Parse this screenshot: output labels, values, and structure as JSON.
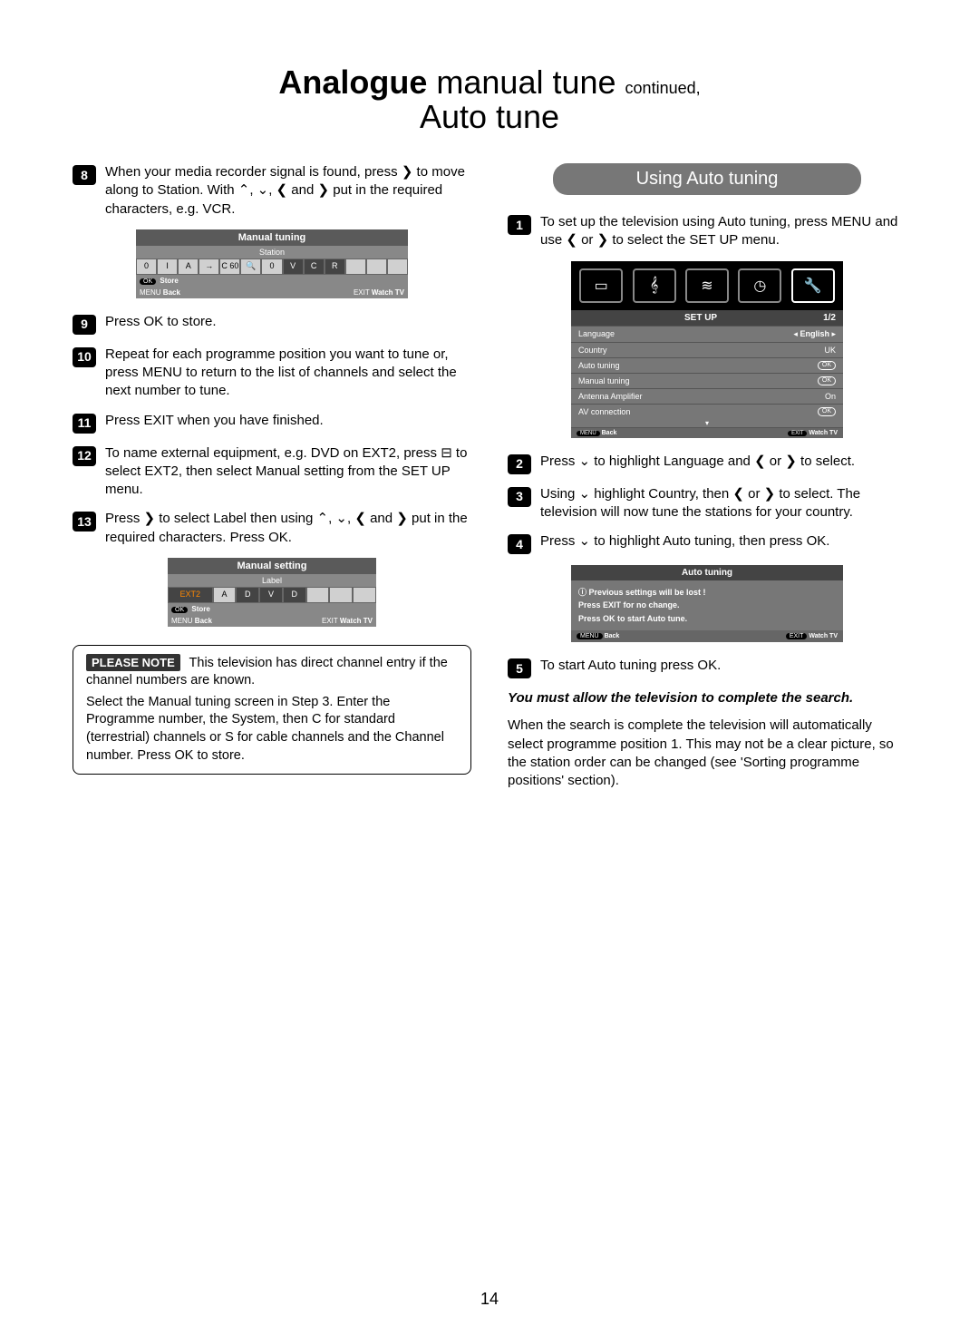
{
  "title": {
    "bold": "Analogue",
    "rest": " manual tune ",
    "cont": "continued,",
    "line2": "Auto tune"
  },
  "left": {
    "step8": "When your media recorder signal is found, press ❯ to move along to Station. With ⌃, ⌄, ❮ and ❯ put in the required characters, e.g. VCR.",
    "osd1": {
      "title": "Manual tuning",
      "sub": "Station",
      "cells": [
        "0",
        "I",
        "A",
        "→",
        "C 60",
        "🔍",
        "0",
        "V",
        "C",
        "R",
        "",
        "",
        ""
      ],
      "f1a": "OK",
      "f1b": "Store",
      "f2a": "MENU",
      "f2b": "Back",
      "f3a": "EXIT",
      "f3b": "Watch TV"
    },
    "step9": "Press OK to store.",
    "step10": "Repeat for each programme position you want to tune or, press MENU to return to the list of channels and select the next number to tune.",
    "step11": "Press EXIT when you have finished.",
    "step12": "To name external equipment, e.g. DVD on EXT2, press  ⊟  to select EXT2, then select Manual setting from the SET UP menu.",
    "step13": "Press ❯ to select Label then using ⌃, ⌄, ❮ and ❯ put in the required characters. Press OK.",
    "osd2": {
      "title": "Manual setting",
      "sub": "Label",
      "ext": "EXT2",
      "cells": [
        "A",
        "D",
        "V",
        "D",
        "",
        "",
        "",
        ""
      ],
      "f1a": "OK",
      "f1b": "Store",
      "f2a": "MENU",
      "f2b": "Back",
      "f3a": "EXIT",
      "f3b": "Watch TV"
    },
    "note": {
      "badge": "PLEASE NOTE",
      "l1": "This television has direct channel entry if the channel numbers are known.",
      "l2": "Select the Manual tuning screen in Step 3. Enter the Programme number, the System, then C for standard (terrestrial) channels or S for cable channels and the Channel number. Press OK to store."
    }
  },
  "right": {
    "header": "Using Auto tuning",
    "step1": "To set up the television using Auto tuning, press MENU and use ❮ or ❯ to select the SET UP menu.",
    "setup": {
      "title": "SET UP",
      "page": "1/2",
      "rows": [
        {
          "k": "Language",
          "v": "English",
          "arrows": true
        },
        {
          "k": "Country",
          "v": "UK"
        },
        {
          "k": "Auto tuning",
          "v": "OK",
          "pill": true
        },
        {
          "k": "Manual tuning",
          "v": "OK",
          "pill": true
        },
        {
          "k": "Antenna Amplifier",
          "v": "On"
        },
        {
          "k": "AV connection",
          "v": "OK",
          "pill": true
        }
      ],
      "f1a": "MENU",
      "f1b": "Back",
      "f2a": "EXIT",
      "f2b": "Watch TV"
    },
    "step2": "Press ⌄ to highlight Language and ❮ or ❯ to select.",
    "step3": "Using ⌄ highlight Country, then ❮ or ❯ to select. The television will now tune the stations for your country.",
    "step4": "Press ⌄ to highlight Auto tuning, then press OK.",
    "auto_osd": {
      "title": "Auto tuning",
      "l1": "ⓘ Previous settings will be lost  !",
      "l2": "Press EXIT for no change.",
      "l3": "Press OK to start Auto tune.",
      "f1a": "MENU",
      "f1b": "Back",
      "f2a": "EXIT",
      "f2b": "Watch TV"
    },
    "step5": "To start Auto tuning press OK.",
    "emph": "You must allow the television to complete the search.",
    "para": "When the search is complete the television will automatically select programme position 1. This may not be a clear picture, so the station order can be changed (see 'Sorting programme positions' section)."
  },
  "pagenum": "14"
}
